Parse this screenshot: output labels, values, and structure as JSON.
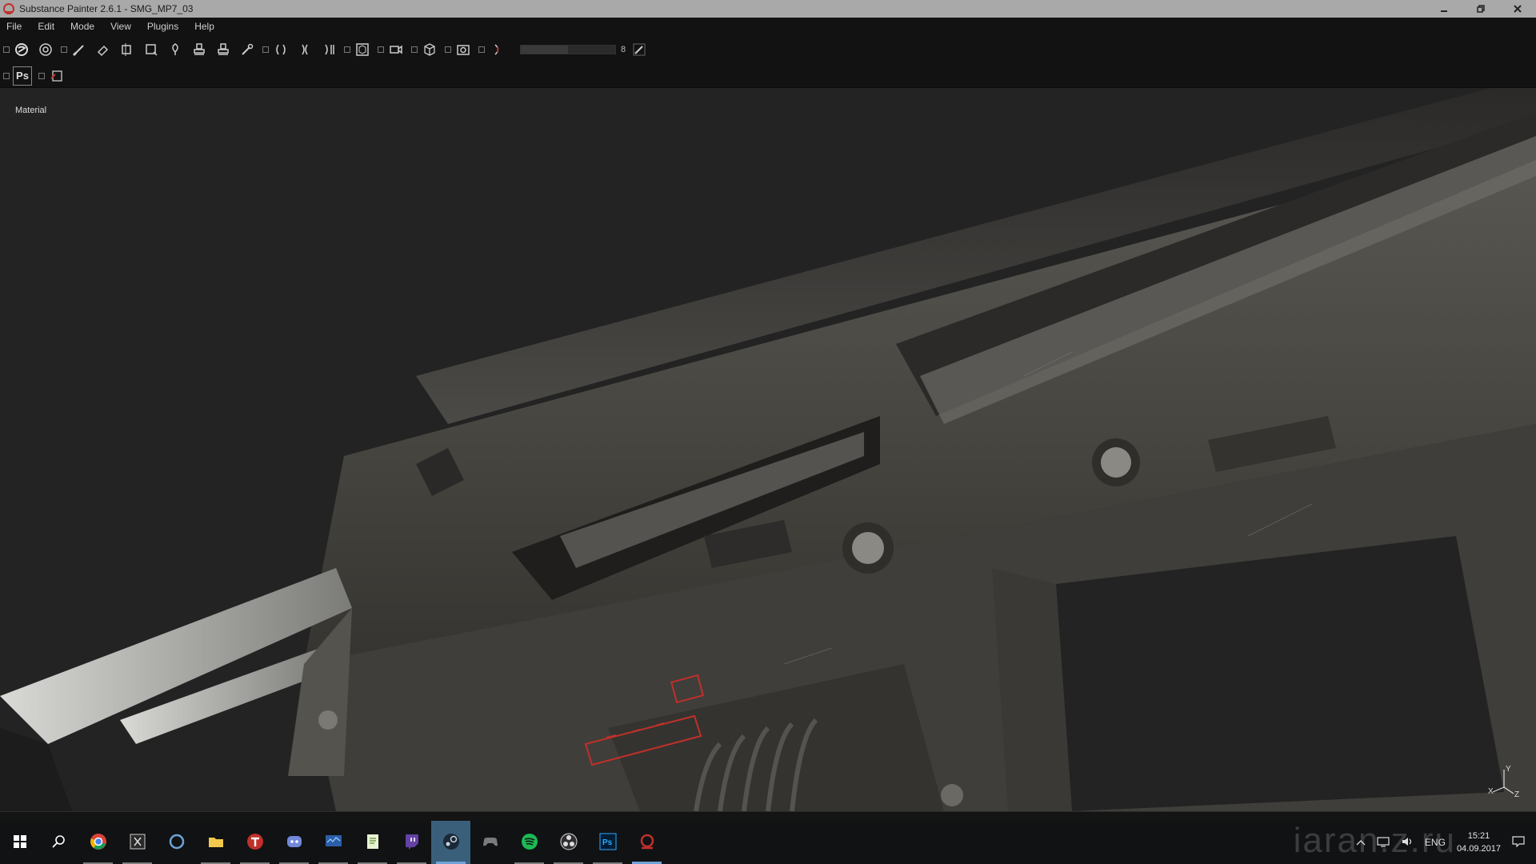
{
  "window": {
    "title": "Substance Painter 2.6.1 - SMG_MP7_03",
    "controls": [
      "minimize",
      "restore",
      "close"
    ]
  },
  "menu": {
    "items": [
      "File",
      "Edit",
      "Mode",
      "View",
      "Plugins",
      "Help"
    ]
  },
  "toolbar": {
    "tools": [
      "substance-logo",
      "material-picker",
      "paint-brush",
      "eraser",
      "projection",
      "polygon-fill",
      "smudge",
      "clone",
      "fill",
      "color-picker",
      "symmetry-x",
      "symmetry-y",
      "symmetry-z",
      "camera-perspective",
      "camera-video",
      "cube-view",
      "screenshot",
      "half-circle"
    ],
    "slider_value": "8",
    "slider_fraction": 0.5,
    "secondary": [
      "photoshop-export",
      "export-document"
    ],
    "ps_label": "Ps"
  },
  "viewport": {
    "label": "Material",
    "axis": {
      "x": "X",
      "y": "Y",
      "z": "Z"
    }
  },
  "taskbar": {
    "apps": [
      {
        "name": "windows-start-icon",
        "state": ""
      },
      {
        "name": "search-icon",
        "state": ""
      },
      {
        "name": "chrome-icon",
        "state": "running"
      },
      {
        "name": "epic-games-icon",
        "state": "running"
      },
      {
        "name": "cortana-icon",
        "state": ""
      },
      {
        "name": "file-explorer-icon",
        "state": "running"
      },
      {
        "name": "t-app-icon",
        "state": "running"
      },
      {
        "name": "discord-icon",
        "state": "running"
      },
      {
        "name": "monitor-app-icon",
        "state": "running"
      },
      {
        "name": "notepad-icon",
        "state": "running"
      },
      {
        "name": "twitch-icon",
        "state": "running"
      },
      {
        "name": "steam-icon",
        "state": "active"
      },
      {
        "name": "gamepad-icon",
        "state": ""
      },
      {
        "name": "spotify-icon",
        "state": "running"
      },
      {
        "name": "obs-icon",
        "state": "running"
      },
      {
        "name": "photoshop-icon",
        "state": "running"
      },
      {
        "name": "substance-painter-icon",
        "state": "active"
      }
    ],
    "tray": {
      "lang": "ENG",
      "time": "15:21",
      "date": "04.09.2017"
    },
    "watermark": "iaran.z.ru"
  },
  "colors": {
    "titlebar": "#a9a9a9",
    "menu_bg": "#121212",
    "viewport_bg": "#232323",
    "gun_body": "#4b4945",
    "gun_dark": "#2c2b2a",
    "metal": "#8a8a88",
    "decal_red": "#c0302a",
    "steam_active": "#3a5f7a"
  }
}
